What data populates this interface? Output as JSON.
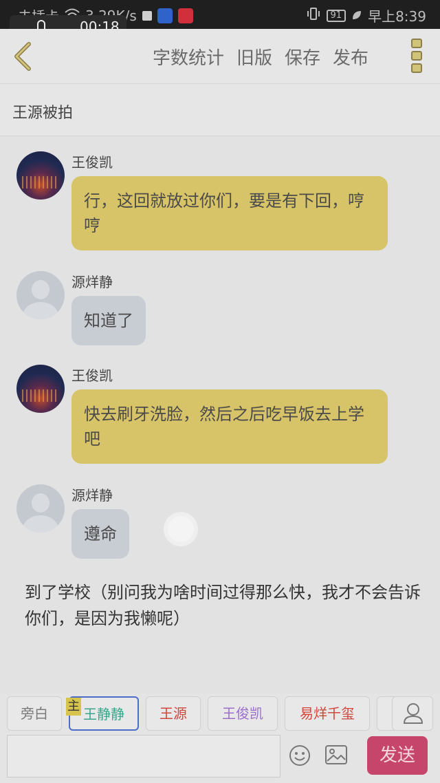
{
  "status_bar": {
    "carrier": "未插卡",
    "speed": "3.29K/s",
    "battery": "91",
    "time": "早上8:39"
  },
  "recording": {
    "time": "00:18"
  },
  "header": {
    "actions": [
      "字数统计",
      "旧版",
      "保存",
      "发布"
    ]
  },
  "title": "王源被拍",
  "messages": [
    {
      "name": "王俊凯",
      "text": "行，这回就放过你们，要是有下回，哼哼"
    },
    {
      "name": "源烊静",
      "text": "知道了"
    },
    {
      "name": "王俊凯",
      "text": "快去刷牙洗脸，然后之后吃早饭去上学吧"
    },
    {
      "name": "源烊静",
      "text": "遵命"
    }
  ],
  "narration": "到了学校（别问我为啥时间过得那么快，我才不会告诉你们，是因为我懒呢）",
  "roles": [
    {
      "label": "旁白",
      "color": "#7a7a7a"
    },
    {
      "label": "王静静",
      "color": "#3aa58c"
    },
    {
      "label": "王源",
      "color": "#d1453b"
    },
    {
      "label": "王俊凯",
      "color": "#9b6fc9"
    },
    {
      "label": "易烊千玺",
      "color": "#d1453b"
    }
  ],
  "role_badge": "主",
  "send_label": "发送",
  "colors": {
    "accent_yellow": "#d8c468",
    "send": "#c5466a"
  }
}
